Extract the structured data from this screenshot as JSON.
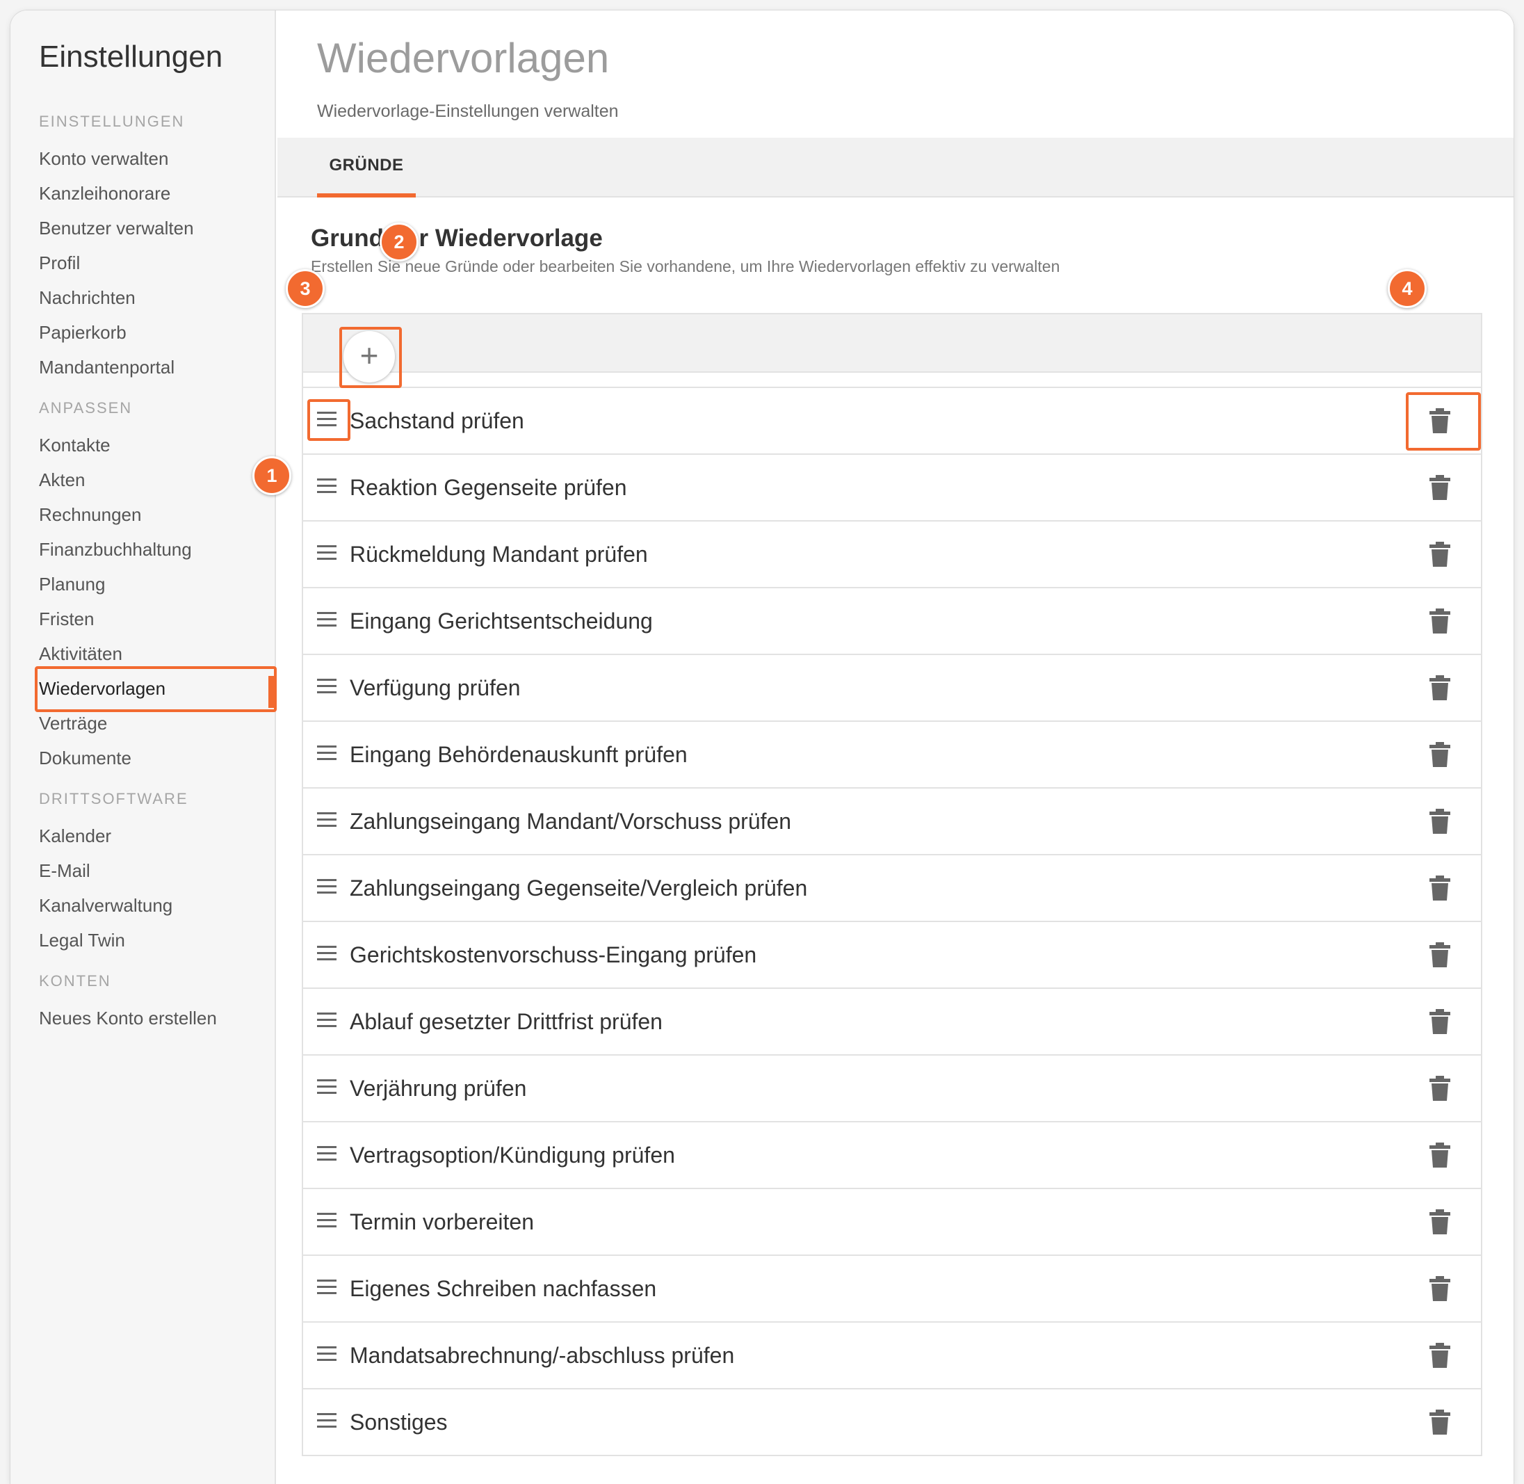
{
  "sidebar": {
    "title": "Einstellungen",
    "groups": [
      {
        "heading": "EINSTELLUNGEN",
        "items": [
          "Konto verwalten",
          "Kanzleihonorare",
          "Benutzer verwalten",
          "Profil",
          "Nachrichten",
          "Papierkorb",
          "Mandantenportal"
        ]
      },
      {
        "heading": "ANPASSEN",
        "items": [
          "Kontakte",
          "Akten",
          "Rechnungen",
          "Finanzbuchhaltung",
          "Planung",
          "Fristen",
          "Aktivitäten",
          "Wiedervorlagen",
          "Verträge",
          "Dokumente"
        ]
      },
      {
        "heading": "DRITTSOFTWARE",
        "items": [
          "Kalender",
          "E-Mail",
          "Kanalverwaltung",
          "Legal Twin"
        ]
      },
      {
        "heading": "KONTEN",
        "items": [
          "Neues Konto erstellen"
        ]
      }
    ],
    "active_item": "Wiedervorlagen"
  },
  "header": {
    "title": "Wiedervorlagen",
    "subtitle": "Wiedervorlage-Einstellungen verwalten"
  },
  "tabs": [
    {
      "label": "GRÜNDE",
      "active": true
    }
  ],
  "section": {
    "title": "Grund der Wiedervorlage",
    "description": "Erstellen Sie neue Gründe oder bearbeiten Sie vorhandene, um Ihre Wiedervorlagen effektiv zu verwalten"
  },
  "toolbar": {
    "add_label": "+"
  },
  "reasons": [
    "Sachstand prüfen",
    "Reaktion Gegenseite prüfen",
    "Rückmeldung Mandant prüfen",
    "Eingang Gerichtsentscheidung",
    "Verfügung prüfen",
    "Eingang Behördenauskunft prüfen",
    "Zahlungseingang Mandant/Vorschuss prüfen",
    "Zahlungseingang Gegenseite/Vergleich prüfen",
    "Gerichtskostenvorschuss-Eingang prüfen",
    "Ablauf gesetzter Drittfrist prüfen",
    "Verjährung prüfen",
    "Vertragsoption/Kündigung prüfen",
    "Termin vorbereiten",
    "Eigenes Schreiben nachfassen",
    "Mandatsabrechnung/-abschluss prüfen",
    "Sonstiges"
  ],
  "badges": [
    "1",
    "2",
    "3",
    "4"
  ],
  "icons": {
    "add": "plus-icon",
    "drag": "drag-handle-icon",
    "delete": "trash-icon"
  },
  "colors": {
    "accent": "#f26a30",
    "icon": "#666666"
  }
}
